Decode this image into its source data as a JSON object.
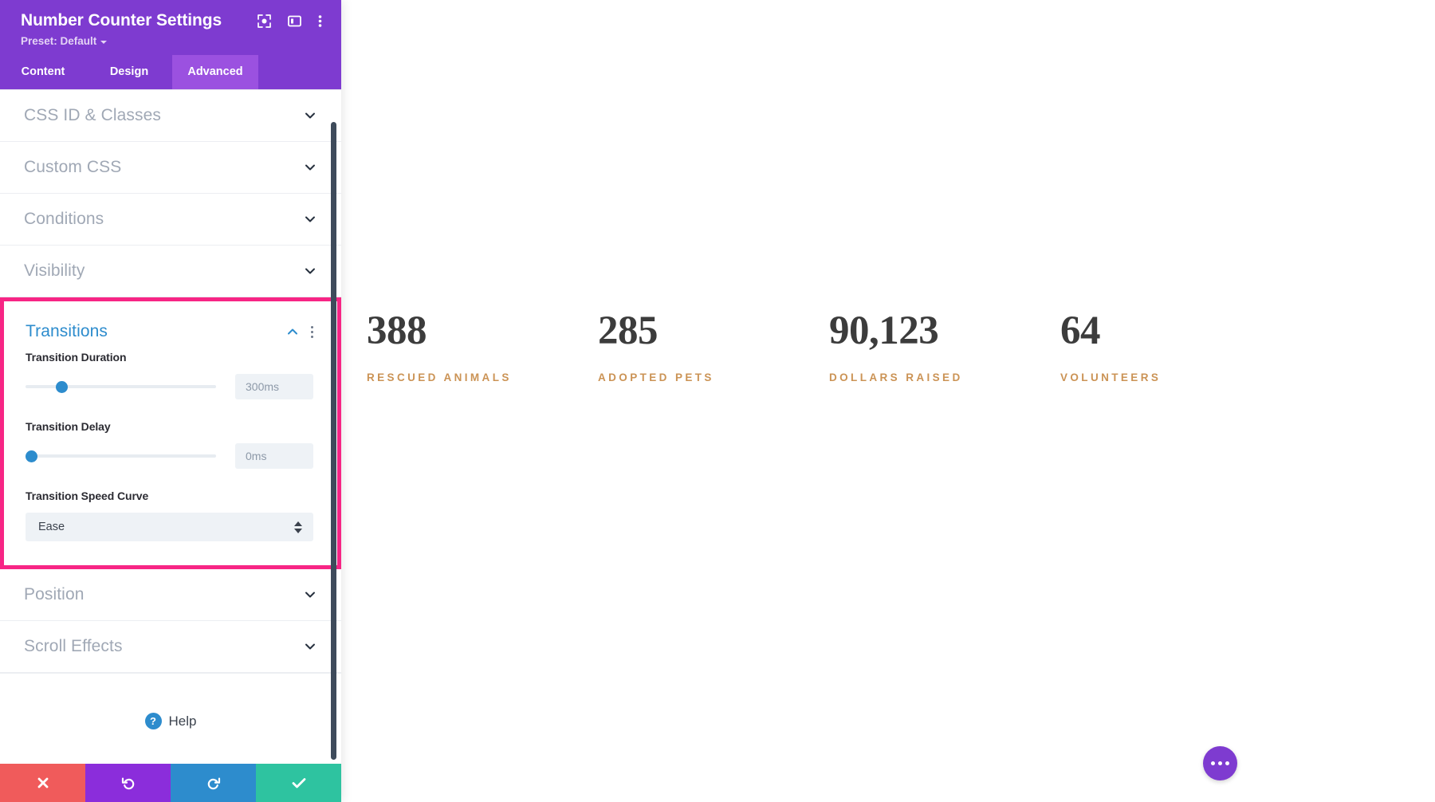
{
  "panel": {
    "title": "Number Counter Settings",
    "preset_label": "Preset: Default",
    "header_icons": [
      {
        "name": "focus-icon"
      },
      {
        "name": "split-view-icon"
      },
      {
        "name": "more-vertical-icon"
      }
    ],
    "tabs": [
      {
        "label": "Content",
        "active": false
      },
      {
        "label": "Design",
        "active": false
      },
      {
        "label": "Advanced",
        "active": true
      }
    ],
    "sections_above": [
      {
        "label": "CSS ID & Classes",
        "expanded": false
      },
      {
        "label": "Custom CSS",
        "expanded": false
      },
      {
        "label": "Conditions",
        "expanded": false
      },
      {
        "label": "Visibility",
        "expanded": false
      }
    ],
    "transitions": {
      "title": "Transitions",
      "expanded": true,
      "highlight_color": "#f72585",
      "accent_color": "#2d8ccd",
      "duration": {
        "label": "Transition Duration",
        "value": "300ms",
        "knob_percent": 17
      },
      "delay": {
        "label": "Transition Delay",
        "value": "0ms",
        "knob_percent": 0
      },
      "speed_curve": {
        "label": "Transition Speed Curve",
        "value": "Ease"
      }
    },
    "sections_below": [
      {
        "label": "Position",
        "expanded": false
      },
      {
        "label": "Scroll Effects",
        "expanded": false
      }
    ],
    "help": {
      "badge": "?",
      "label": "Help"
    },
    "actions": [
      {
        "name": "cancel-button",
        "icon": "close-icon",
        "color": "#f05b5b"
      },
      {
        "name": "undo-button",
        "icon": "undo-icon",
        "color": "#8b2ddb"
      },
      {
        "name": "redo-button",
        "icon": "redo-icon",
        "color": "#2d8ccd"
      },
      {
        "name": "save-button",
        "icon": "check-icon",
        "color": "#2ec3a0"
      }
    ]
  },
  "canvas": {
    "counters": [
      {
        "number": "388",
        "label": "RESCUED ANIMALS"
      },
      {
        "number": "285",
        "label": "ADOPTED PETS"
      },
      {
        "number": "90,123",
        "label": "DOLLARS RAISED"
      },
      {
        "number": "64",
        "label": "VOLUNTEERS"
      }
    ],
    "number_color": "#3c3c3c",
    "label_color": "#cb9355",
    "fab": {
      "name": "page-settings-fab",
      "icon": "ellipsis-icon",
      "color": "#7e3bd0"
    }
  }
}
